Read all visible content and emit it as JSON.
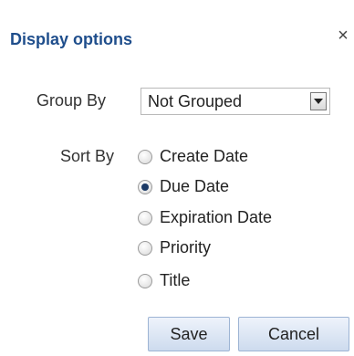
{
  "dialog": {
    "title": "Display options",
    "close_glyph": "×"
  },
  "group_by": {
    "label": "Group By",
    "selected": "Not Grouped"
  },
  "sort_by": {
    "label": "Sort By",
    "options": [
      {
        "label": "Create Date",
        "checked": false
      },
      {
        "label": "Due Date",
        "checked": true
      },
      {
        "label": "Expiration Date",
        "checked": false
      },
      {
        "label": "Priority",
        "checked": false
      },
      {
        "label": "Title",
        "checked": false
      }
    ]
  },
  "buttons": {
    "save": "Save",
    "cancel": "Cancel"
  },
  "colors": {
    "title": "#1f4e8c",
    "radio_selected": "#1b3a66"
  }
}
